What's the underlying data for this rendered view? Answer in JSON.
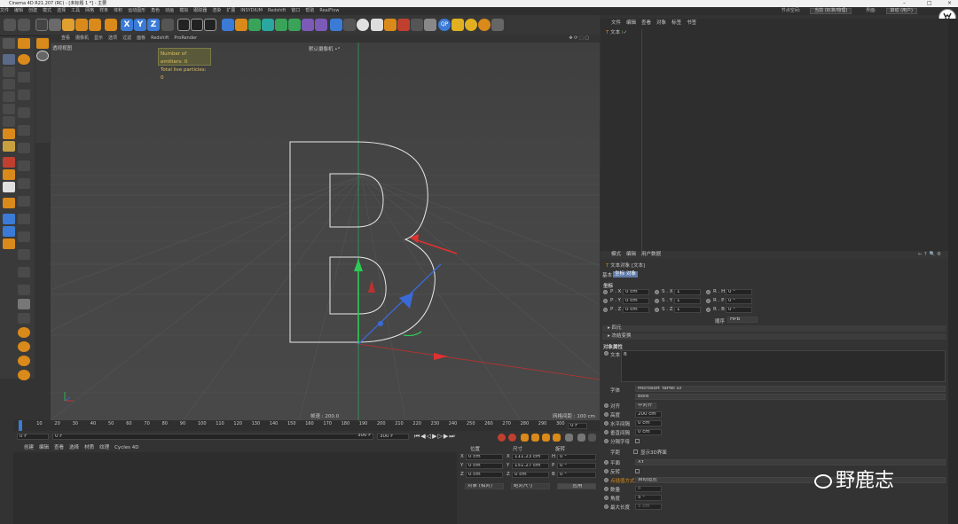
{
  "titlebar": {
    "title": "Cinema 4D R21.207 (RC) - [未标题 1 *] - 主要"
  },
  "menu": {
    "items": [
      "文件",
      "编辑",
      "创建",
      "模式",
      "选择",
      "工具",
      "网格",
      "样条",
      "体积",
      "运动图形",
      "角色",
      "动画",
      "模拟",
      "跟踪器",
      "渲染",
      "扩展",
      "INSYDIUM",
      "Redshift",
      "窗口",
      "帮助",
      "RealFlow"
    ],
    "node_space_label": "节点空间:",
    "node_space_value": "当前 (标准/物理)",
    "interface_label": "界面:",
    "interface_value": "启动 (用户)"
  },
  "toolbar": {
    "axis_x": "X",
    "axis_y": "Y",
    "axis_z": "Z",
    "qp_label": "QP",
    "colors": {
      "blue": "#3b7bd6",
      "orange": "#d98a1a",
      "green": "#3aa35a",
      "teal": "#2aa7a0",
      "purple": "#7b5ab8",
      "red": "#c04030",
      "yellow": "#e0b020",
      "gray": "#5a5a5a"
    }
  },
  "viewport": {
    "menu": [
      "查看",
      "摄像机",
      "显示",
      "选项",
      "过滤",
      "面板",
      "Redshift",
      "ProRender"
    ],
    "label": "透视视图",
    "camera": "默认摄像机 •°",
    "emitters": "Number of emitters: 0",
    "particles": "Total live particles: 0",
    "speed": "帧速 : 200.0",
    "grid": "网格间距 : 100 cm",
    "text_object": "B"
  },
  "timeline": {
    "ticks": [
      "0",
      "10",
      "20",
      "30",
      "40",
      "50",
      "60",
      "70",
      "80",
      "90",
      "100",
      "110",
      "120",
      "130",
      "140",
      "150",
      "160",
      "170",
      "180",
      "190",
      "200",
      "210",
      "220",
      "230",
      "240",
      "250",
      "260",
      "270",
      "280",
      "290",
      "300"
    ],
    "end_frame": "0 F",
    "current": "0 F",
    "start": "0 F",
    "max1": "300 F",
    "max2": "300 F"
  },
  "material_menu": [
    "创建",
    "编辑",
    "查看",
    "选择",
    "材质",
    "纹理",
    "Cycles 4D"
  ],
  "coords": {
    "headers": [
      "位置",
      "尺寸",
      "旋转"
    ],
    "rows": [
      {
        "axis": "X",
        "pos": "0 cm",
        "size": "111.23 cm",
        "rot_label": "H",
        "rot": "0 °"
      },
      {
        "axis": "Y",
        "pos": "0 cm",
        "size": "151.27 cm",
        "rot_label": "P",
        "rot": "0 °"
      },
      {
        "axis": "Z",
        "pos": "0 cm",
        "size": "0 cm",
        "rot_label": "B",
        "rot": "0 °"
      }
    ],
    "mode": "对象 (相对)",
    "size_mode": "绝对尺寸",
    "apply": "应用"
  },
  "object_manager": {
    "menu": [
      "文件",
      "编辑",
      "查看",
      "对象",
      "标签",
      "书签"
    ],
    "object": "文本"
  },
  "attributes": {
    "menu": [
      "模式",
      "编辑",
      "用户数据"
    ],
    "title": "文本对象 [文本]",
    "tabs": [
      "基本",
      "坐标",
      "对象"
    ],
    "coord_label": "坐标",
    "pos": [
      {
        "l": "P . X",
        "v": "0 cm"
      },
      {
        "l": "P . Y",
        "v": "0 cm"
      },
      {
        "l": "P . Z",
        "v": "0 cm"
      }
    ],
    "scale": [
      {
        "l": "S . X",
        "v": "1"
      },
      {
        "l": "S . Y",
        "v": "1"
      },
      {
        "l": "S . Z",
        "v": "1"
      }
    ],
    "rot": [
      {
        "l": "R . H",
        "v": "0 °"
      },
      {
        "l": "R . P",
        "v": "0 °"
      },
      {
        "l": "R . B",
        "v": "0 °"
      }
    ],
    "order_label": "顺序",
    "order_value": "HPB",
    "sec_quat": "▸ 四元",
    "sec_freeze": "▸ 冻结变换",
    "obj_props": "对象属性",
    "text_label": "文本",
    "text_value": "B",
    "font_label": "字体",
    "font_value": "Microsoft YaHei UI",
    "font_style": "Bold",
    "align_label": "对齐",
    "align_value": "中对齐",
    "height_label": "高度",
    "height_value": "200 cm",
    "hspace_label": "水平间隔",
    "hspace_value": "0 cm",
    "vspace_label": "垂直间隔",
    "vspace_value": "0 cm",
    "kern_label": "分隔字母",
    "kerning_label": "字距",
    "kerning_check": "显示3D界面",
    "plane_label": "平面",
    "plane_value": "XY",
    "reverse_label": "反转",
    "interp_label": "点插值方式",
    "interp_value": "自动适应",
    "count_label": "数量",
    "count_value": "8",
    "angle_label": "角度",
    "angle_value": "5 °",
    "maxlen_label": "最大长度",
    "maxlen_value": "5 cm"
  },
  "watermark": "野鹿志"
}
